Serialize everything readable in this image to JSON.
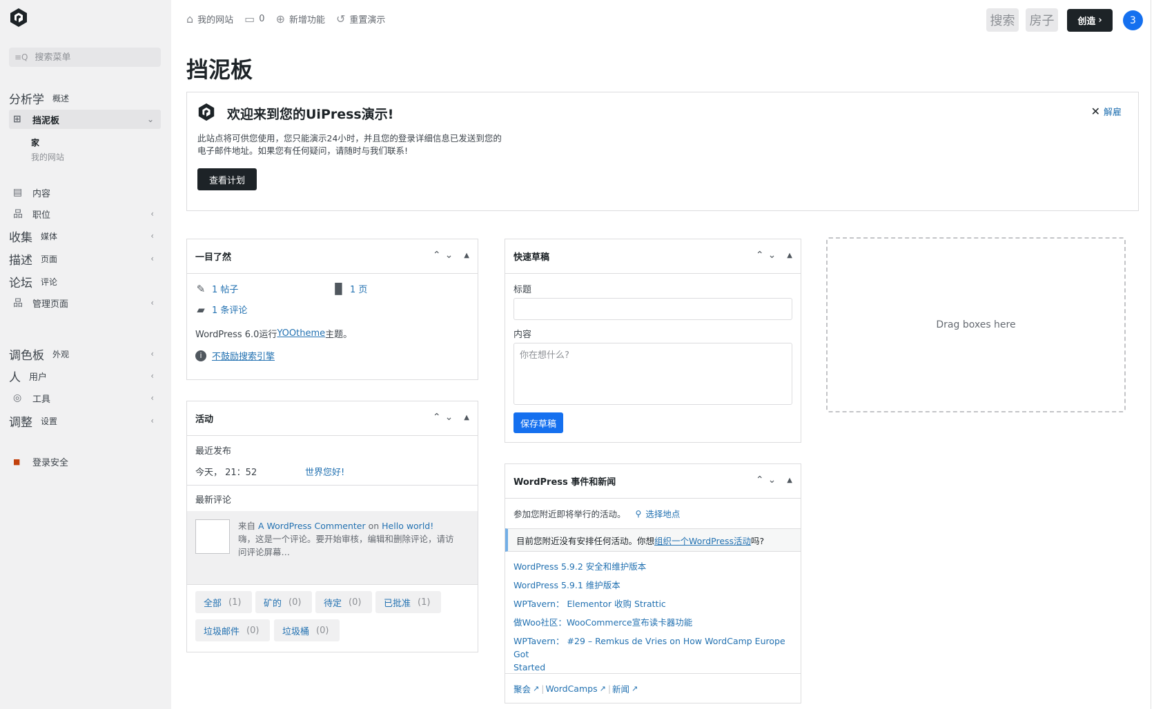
{
  "sidebar": {
    "search_placeholder": "搜索菜单",
    "items": [
      {
        "lead": "分析学",
        "label": "概述"
      },
      {
        "lead": "⊞",
        "label": "挡泥板"
      },
      {
        "lead": "▤",
        "label": "内容"
      },
      {
        "lead": "品",
        "label": "职位"
      },
      {
        "lead": "收集",
        "label": "媒体"
      },
      {
        "lead": "描述",
        "label": "页面"
      },
      {
        "lead": "论坛",
        "label": "评论"
      },
      {
        "lead": "品",
        "label": "管理页面"
      },
      {
        "lead": "调色板",
        "label": "外观"
      },
      {
        "lead": "人",
        "label": "用户"
      },
      {
        "lead": "◎",
        "label": "工具"
      },
      {
        "lead": "调整",
        "label": "设置"
      },
      {
        "lead": "■",
        "label": "登录安全"
      }
    ],
    "subitems": [
      "家",
      "我的网站"
    ]
  },
  "topbar": {
    "site": "我的网站",
    "comments": "0",
    "new": "新增功能",
    "reset": "重置演示",
    "search": "搜索",
    "home": "房子",
    "create": "创造",
    "badge": "3"
  },
  "page_title": "挡泥板",
  "welcome": {
    "title": "欢迎来到您的UiPress演示!",
    "line1": "此站点将可供您使用，您只能演示24小时，并且您的登录详细信息已发送到您的",
    "line2": "电子邮件地址。如果您有任何疑问，请随时与我们联系!",
    "button": "查看计划",
    "dismiss": "解雇"
  },
  "glance": {
    "title": "一目了然",
    "posts": "1 帖子",
    "pages": "1 页",
    "comments": "1 条评论",
    "wp_text": "WordPress 6.0运行",
    "theme": "YOOtheme",
    "wp_suffix": "主题。",
    "discourage": "不鼓励搜索引擎"
  },
  "activity": {
    "title": "活动",
    "recent_published": "最近发布",
    "time": "今天， 21：52",
    "post_link": "世界您好!",
    "recent_comments": "最新评论",
    "from": "来自",
    "commenter": "A WordPress Commenter",
    "on": "on",
    "post": "Hello world!",
    "excerpt1": "嗨，这是一个评论。要开始审核，编辑和删除评论，请访",
    "excerpt2": "问评论屏幕…",
    "filters": [
      {
        "label": "全部",
        "count": "(1)"
      },
      {
        "label": "矿的",
        "count": "(0)"
      },
      {
        "label": "待定",
        "count": "(0)"
      },
      {
        "label": "已批准",
        "count": "(1)"
      },
      {
        "label": "垃圾邮件",
        "count": "(0)"
      },
      {
        "label": "垃圾桶",
        "count": "(0)"
      }
    ]
  },
  "draft": {
    "title": "快速草稿",
    "title_label": "标题",
    "content_label": "内容",
    "content_placeholder": "你在想什么?",
    "save": "保存草稿"
  },
  "news": {
    "title": "WordPress 事件和新闻",
    "intro": "参加您附近即将举行的活动。",
    "select_location": "选择地点",
    "notice_pre": "目前您附近没有安排任何活动。你想",
    "notice_link": "组织一个WordPress活动",
    "notice_post": "吗?",
    "links": [
      "WordPress 5.9.2 安全和维护版本",
      "WordPress 5.9.1 维护版本",
      "WPTavern： Elementor 收购 Strattic",
      "做Woo社区：WooCommerce宣布读卡器功能",
      "WPTavern： #29 – Remkus de Vries on How WordCamp Europe Got",
      "Started"
    ],
    "footer": [
      "聚会",
      "WordCamps",
      "新闻"
    ]
  },
  "dropzone": "Drag boxes here",
  "colors": {
    "accent": "#2271b1",
    "dark": "#1d2327",
    "badge": "#1570ef",
    "save": "#1570ef"
  }
}
